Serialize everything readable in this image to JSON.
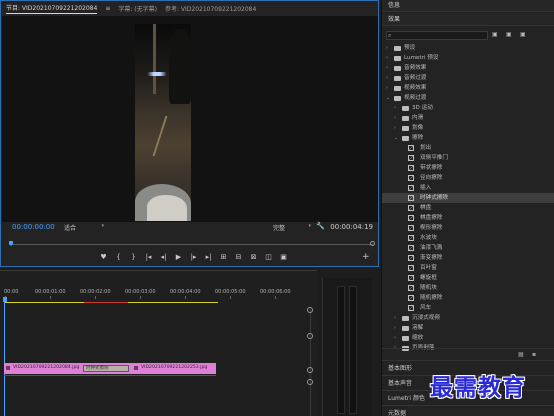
{
  "monitor": {
    "tabs": [
      "节目: VID20210709221202084",
      "字幕: (无字幕)",
      "参考: VID20210709221202084"
    ],
    "tab_menu": "≡",
    "timecode_current": "00:00:00:00",
    "fit": "适合",
    "quality": "完整",
    "timecode_duration": "00:00:04:19",
    "transport": [
      "♥",
      "{",
      "}",
      "|◂",
      "◂|",
      "▶",
      "|▸",
      "▸|",
      "⊞",
      "⊟",
      "⊠",
      "◫",
      "▣"
    ],
    "add": "+"
  },
  "timeline": {
    "ruler": [
      "00:00",
      "00:00:01:00",
      "00:00:02:00",
      "00:00:03:00",
      "00:00:04:00",
      "00:00:05:00",
      "00:00:06:00"
    ],
    "clip_a": "VID20210709221202084.jpg",
    "transition": "时钟式擦除",
    "clip_b": "VID20210709221202253.jpg"
  },
  "right_panel": {
    "info": "信息",
    "effects": "效果",
    "search_icons": [
      "▣",
      "▣",
      "▣"
    ],
    "tree": [
      {
        "label": "预设",
        "type": "folder",
        "level": 0,
        "open": false
      },
      {
        "label": "Lumetri 预设",
        "type": "folder",
        "level": 0,
        "open": false
      },
      {
        "label": "音频效果",
        "type": "folder",
        "level": 0,
        "open": false
      },
      {
        "label": "音频过渡",
        "type": "folder",
        "level": 0,
        "open": false
      },
      {
        "label": "视频效果",
        "type": "folder",
        "level": 0,
        "open": false
      },
      {
        "label": "视频过渡",
        "type": "folder",
        "level": 0,
        "open": true
      },
      {
        "label": "3D 运动",
        "type": "folder",
        "level": 1,
        "open": false
      },
      {
        "label": "内滑",
        "type": "folder",
        "level": 1,
        "open": false
      },
      {
        "label": "划像",
        "type": "folder",
        "level": 1,
        "open": false
      },
      {
        "label": "擦除",
        "type": "folder",
        "level": 1,
        "open": true
      },
      {
        "label": "划出",
        "type": "fx",
        "level": 2
      },
      {
        "label": "双侧平推门",
        "type": "fx",
        "level": 2
      },
      {
        "label": "带状擦除",
        "type": "fx",
        "level": 2
      },
      {
        "label": "径向擦除",
        "type": "fx",
        "level": 2
      },
      {
        "label": "插入",
        "type": "fx",
        "level": 2
      },
      {
        "label": "时钟式擦除",
        "type": "fx",
        "level": 2,
        "selected": true
      },
      {
        "label": "棋盘",
        "type": "fx",
        "level": 2
      },
      {
        "label": "棋盘擦除",
        "type": "fx",
        "level": 2
      },
      {
        "label": "楔形擦除",
        "type": "fx",
        "level": 2
      },
      {
        "label": "水波块",
        "type": "fx",
        "level": 2
      },
      {
        "label": "油漆飞溅",
        "type": "fx",
        "level": 2
      },
      {
        "label": "渐变擦除",
        "type": "fx",
        "level": 2
      },
      {
        "label": "百叶窗",
        "type": "fx",
        "level": 2
      },
      {
        "label": "螺旋框",
        "type": "fx",
        "level": 2
      },
      {
        "label": "随机块",
        "type": "fx",
        "level": 2
      },
      {
        "label": "随机擦除",
        "type": "fx",
        "level": 2
      },
      {
        "label": "风车",
        "type": "fx",
        "level": 2
      },
      {
        "label": "沉浸式视频",
        "type": "folder",
        "level": 1,
        "open": false
      },
      {
        "label": "溶解",
        "type": "folder",
        "level": 1,
        "open": false
      },
      {
        "label": "缩放",
        "type": "folder",
        "level": 1,
        "open": false
      },
      {
        "label": "页面剥落",
        "type": "folder",
        "level": 1,
        "open": false
      }
    ],
    "bottom_icons": [
      "▦",
      "▪"
    ],
    "panels": [
      "基本图形",
      "基本声音",
      "Lumetri 颜色",
      "元数据"
    ]
  },
  "watermark": "最需教育"
}
